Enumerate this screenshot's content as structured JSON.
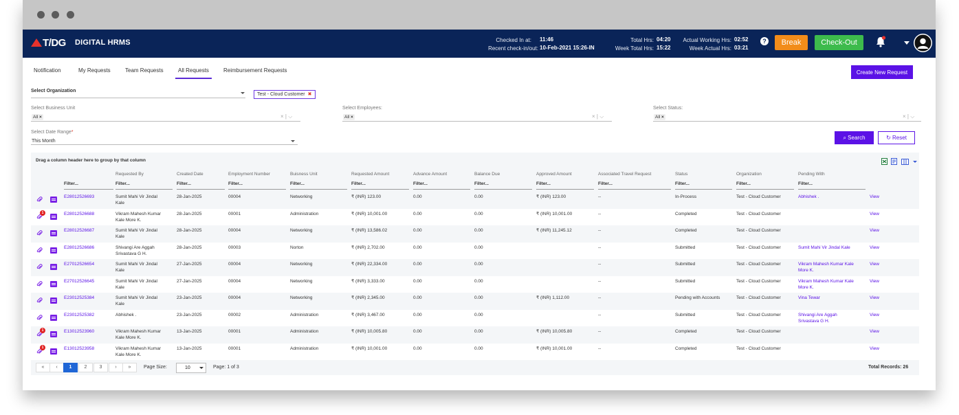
{
  "header": {
    "logo": "T/DG",
    "app_title": "DIGITAL HRMS",
    "checked_in_label": "Checked In at:",
    "checked_in_value": "11:46",
    "recent_label": "Recent check-in/out:",
    "recent_value": "10-Feb-2021 15:26-IN",
    "total_hrs_label": "Total Hrs:",
    "total_hrs_value": "04:20",
    "week_total_label": "Week Total Hrs:",
    "week_total_value": "15:22",
    "actual_working_label": "Actual Working Hrs:",
    "actual_working_value": "02:52",
    "week_actual_label": "Week Actual Hrs:",
    "week_actual_value": "03:21",
    "help": "?",
    "break_label": "Break",
    "checkout_label": "Check-Out",
    "break_color": "#f28c1a",
    "checkout_color": "#3dbb4c"
  },
  "tabs": [
    "Notification",
    "My Requests",
    "Team Requests",
    "All Requests",
    "Reimbursement Requests"
  ],
  "active_tab": "All Requests",
  "new_request_label": "Create New Request",
  "filters": {
    "organization_label": "Select Organization",
    "organization_tag": "Test - Cloud Customer",
    "business_unit_label": "Select Business Unit",
    "business_unit_chip": "All",
    "employees_label": "Select Employees:",
    "employees_chip": "All",
    "status_label": "Select Status:",
    "status_chip": "All",
    "date_range_label": "Select Date Range",
    "date_range_value": "This Month",
    "search_label": "Search",
    "reset_label": "Reset"
  },
  "grid": {
    "group_hint": "Drag a column header here to group by that column",
    "filter_placeholder": "Filter...",
    "columns": [
      "Requested By",
      "Created Date",
      "Employment Number",
      "Buisness Unit",
      "Requested Amount",
      "Advance Amount",
      "Balance Due",
      "Approved Amount",
      "Associated Travel Request",
      "Status",
      "Organization",
      "Pending With"
    ],
    "view_label": "View",
    "rows": [
      {
        "id": "E28012526693",
        "badge": "",
        "by": [
          "Sumit Mahi Vir Jindal",
          "Kale"
        ],
        "date": "28-Jan-2025",
        "emp": "00004",
        "bu": "Networking",
        "req": "₹ (INR) 123.00",
        "adv": "0.00",
        "bal": "0.00",
        "appr": "₹ (INR) 123.00",
        "travel": "--",
        "status": "In-Process",
        "org": "Test - Cloud Customer",
        "pending": [
          "Abhishek .",
          ""
        ]
      },
      {
        "id": "E28012526688",
        "badge": "1",
        "by": [
          "Vikram Mahesh Kumar",
          "Kale More K."
        ],
        "date": "28-Jan-2025",
        "emp": "00001",
        "bu": "Administration",
        "req": "₹ (INR) 10,001.00",
        "adv": "0.00",
        "bal": "0.00",
        "appr": "₹ (INR) 10,001.00",
        "travel": "--",
        "status": "Completed",
        "org": "Test - Cloud Customer",
        "pending": [
          "",
          ""
        ]
      },
      {
        "id": "E28012526687",
        "badge": "",
        "by": [
          "Sumit Mahi Vir Jindal",
          "Kale"
        ],
        "date": "28-Jan-2025",
        "emp": "00004",
        "bu": "Networking",
        "req": "₹ (INR) 13,586.02",
        "adv": "0.00",
        "bal": "0.00",
        "appr": "₹ (INR) 11,245.12",
        "travel": "--",
        "status": "Completed",
        "org": "Test - Cloud Customer",
        "pending": [
          "",
          ""
        ]
      },
      {
        "id": "E28012526686",
        "badge": "",
        "by": [
          "Shivangi Are Aggah",
          "Srivastava G H."
        ],
        "date": "28-Jan-2025",
        "emp": "00003",
        "bu": "Norton",
        "req": "₹ (INR) 2,702.00",
        "adv": "0.00",
        "bal": "0.00",
        "appr": "",
        "travel": "--",
        "status": "Submitted",
        "org": "Test - Cloud Customer",
        "pending": [
          "Sumit Mahi Vir Jindal Kale",
          ""
        ]
      },
      {
        "id": "E27012526654",
        "badge": "",
        "by": [
          "Sumit Mahi Vir Jindal",
          "Kale"
        ],
        "date": "27-Jan-2025",
        "emp": "00004",
        "bu": "Networking",
        "req": "₹ (INR) 22,334.00",
        "adv": "0.00",
        "bal": "0.00",
        "appr": "",
        "travel": "--",
        "status": "Submitted",
        "org": "Test - Cloud Customer",
        "pending": [
          "Vikram Mahesh Kumar Kale",
          "More K."
        ]
      },
      {
        "id": "E27012526645",
        "badge": "",
        "by": [
          "Sumit Mahi Vir Jindal",
          "Kale"
        ],
        "date": "27-Jan-2025",
        "emp": "00004",
        "bu": "Networking",
        "req": "₹ (INR) 3,333.00",
        "adv": "0.00",
        "bal": "0.00",
        "appr": "",
        "travel": "--",
        "status": "Submitted",
        "org": "Test - Cloud Customer",
        "pending": [
          "Vikram Mahesh Kumar Kale",
          "More K."
        ]
      },
      {
        "id": "E23012525384",
        "badge": "",
        "by": [
          "Sumit Mahi Vir Jindal",
          "Kale"
        ],
        "date": "23-Jan-2025",
        "emp": "00004",
        "bu": "Networking",
        "req": "₹ (INR) 2,345.00",
        "adv": "0.00",
        "bal": "0.00",
        "appr": "₹ (INR) 1,112.00",
        "travel": "--",
        "status": "Pending with Accounts",
        "org": "Test - Cloud Customer",
        "pending": [
          "Vina Tewar",
          ""
        ]
      },
      {
        "id": "E23012525382",
        "badge": "",
        "by": [
          "Abhishek .",
          ""
        ],
        "date": "23-Jan-2025",
        "emp": "00002",
        "bu": "Administration",
        "req": "₹ (INR) 3,467.00",
        "adv": "0.00",
        "bal": "0.00",
        "appr": "",
        "travel": "--",
        "status": "Submitted",
        "org": "Test - Cloud Customer",
        "pending": [
          "Shivangi Are Aggah",
          "Srivastava G H."
        ]
      },
      {
        "id": "E13012523960",
        "badge": "1",
        "by": [
          "Vikram Mahesh Kumar",
          "Kale More K."
        ],
        "date": "13-Jan-2025",
        "emp": "00001",
        "bu": "Administration",
        "req": "₹ (INR) 10,005.80",
        "adv": "0.00",
        "bal": "0.00",
        "appr": "₹ (INR) 10,005.80",
        "travel": "--",
        "status": "Completed",
        "org": "Test - Cloud Customer",
        "pending": [
          "",
          ""
        ]
      },
      {
        "id": "E13012523958",
        "badge": "1",
        "by": [
          "Vikram Mahesh Kumar",
          "Kale More K."
        ],
        "date": "13-Jan-2025",
        "emp": "00001",
        "bu": "Administration",
        "req": "₹ (INR) 10,001.00",
        "adv": "0.00",
        "bal": "0.00",
        "appr": "₹ (INR) 10,001.00",
        "travel": "--",
        "status": "Completed",
        "org": "Test - Cloud Customer",
        "pending": [
          "",
          ""
        ]
      }
    ]
  },
  "pager": {
    "first": "«",
    "prev": "‹",
    "pages": [
      "1",
      "2",
      "3"
    ],
    "next": "›",
    "last": "»",
    "page_size_label": "Page Size:",
    "page_size": "10",
    "page_info": "Page: 1 of 3",
    "total_records": "Total Records: 26"
  }
}
